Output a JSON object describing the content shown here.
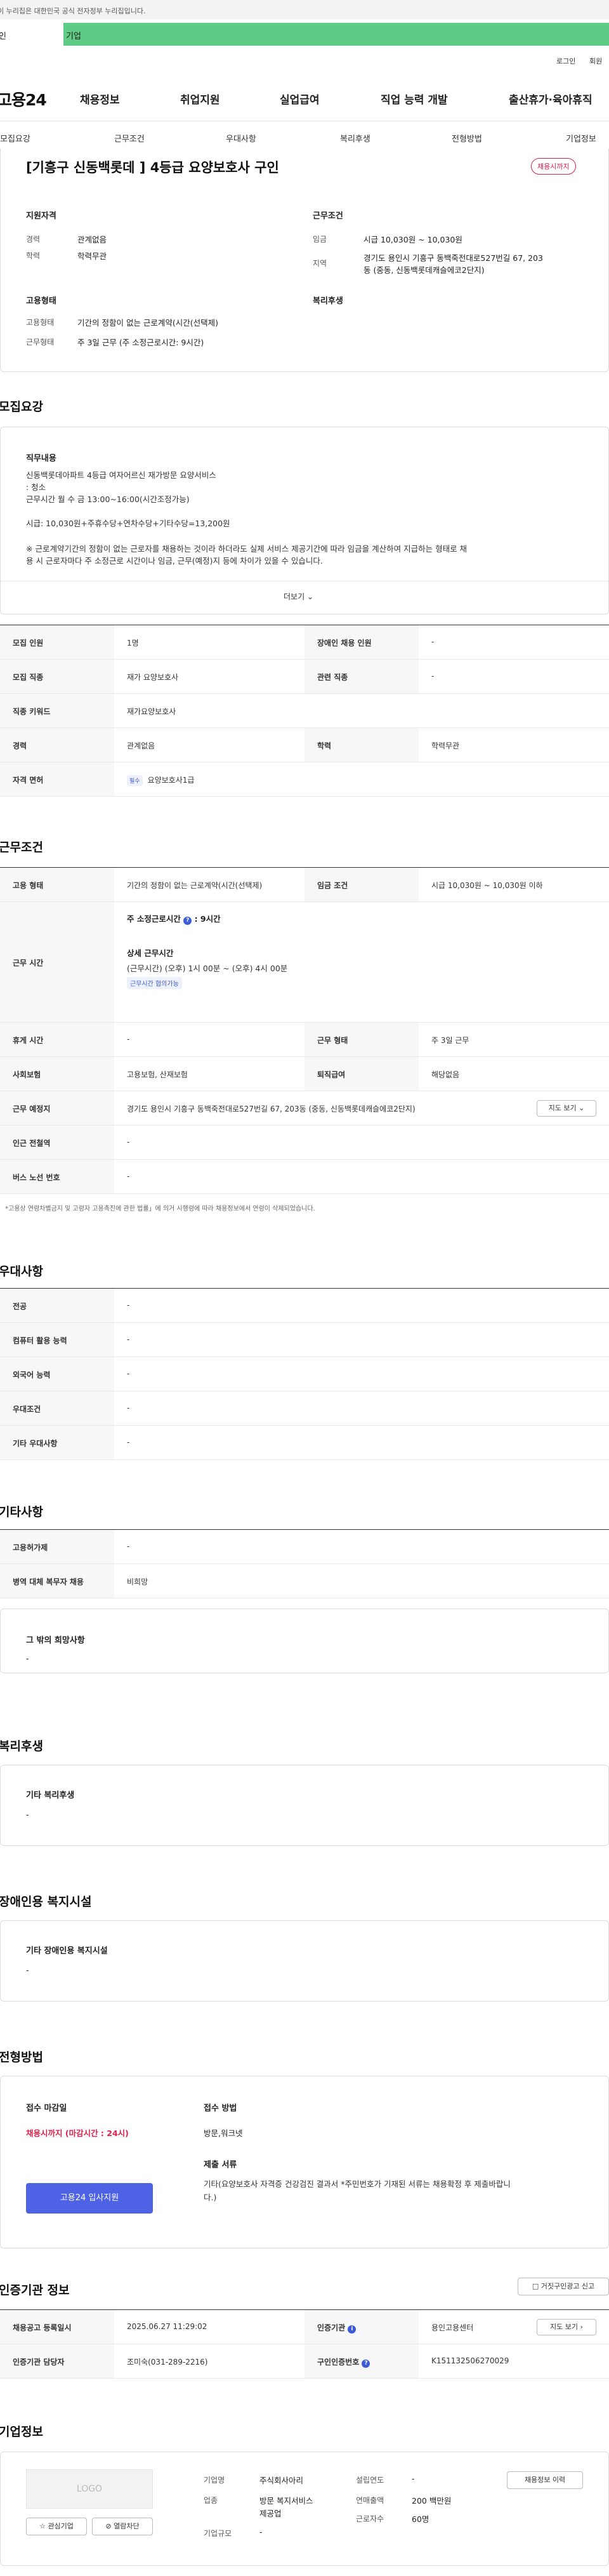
{
  "topbar": {
    "notice": "이 누리집은 대한민국 공식 전자정부 누리집입니다."
  },
  "banner": {
    "left": "인",
    "text": "기업"
  },
  "util": {
    "login": "로그인",
    "join": "회원"
  },
  "header": {
    "logo": "고용24",
    "nav": [
      "채용정보",
      "취업지원",
      "실업급여",
      "직업 능력 개발",
      "출산휴가·육아휴직"
    ]
  },
  "tabs": [
    "모집요강",
    "근무조건",
    "우대사항",
    "복리후생",
    "전형방법",
    "기업정보"
  ],
  "job": {
    "title": "[기흥구 신동백롯데 ] 4등급 요양보호사 구인",
    "status": "채용시까지",
    "qual_title": "지원자격",
    "qual": [
      {
        "label": "경력",
        "value": "관계없음"
      },
      {
        "label": "학력",
        "value": "학력무관"
      }
    ],
    "cond_title": "근무조건",
    "cond": [
      {
        "label": "임금",
        "value": "시급 10,030원 ~ 10,030원"
      },
      {
        "label": "지역",
        "value": "경기도 용인시 기흥구 동백죽전대로527번길 67, 203"
      },
      {
        "label": "",
        "value": "동 (중동, 신동백롯데캐슬에코2단지)"
      }
    ],
    "emp_title": "고용형태",
    "emp": [
      {
        "label": "고용형태",
        "value": "기간의 정함이 없는 근로계약(시간(선택제)"
      },
      {
        "label": "근무형태",
        "value": "주 3일 근무 (주 소정근로시간: 9시간)"
      }
    ],
    "welfare_title": "복리후생"
  },
  "recruit": {
    "title": "모집요강",
    "duty_title": "직무내용",
    "duty_lines": [
      "신동백롯데아파트 4등급 여자어르신 재가방문 요양서비스",
      ": 청소",
      "근무시간 월 수 금 13:00~16:00(시간조정가능)",
      "",
      "시급: 10,030원+주휴수당+연차수당+기타수당=13,200원",
      "",
      "※ 근로계약기간의 정함이 없는 근로자를 채용하는 것이라 하더라도 실제 서비스 제공기간에 따라 임금을 계산하여 지급하는 형태로 채",
      "용 시 근로자마다 주 소정근로 시간이나 임금, 근무(예정)지 등에 차이가 있을 수 있습니다."
    ],
    "more": "더보기",
    "rows": [
      {
        "l1": "모집 인원",
        "v1": "1명",
        "l2": "장애인 채용 인원",
        "v2": "-"
      },
      {
        "l1": "모집 직종",
        "v1": "재가 요양보호사",
        "l2": "관련 직종",
        "v2": "-"
      },
      {
        "l1": "직종 키워드",
        "v1": "재가요양보호사",
        "l2": "",
        "v2": ""
      },
      {
        "l1": "경력",
        "v1": "관계없음",
        "l2": "학력",
        "v2": "학력무관"
      },
      {
        "l1": "자격 면허",
        "v1": "요양보호사1급",
        "l2": "",
        "v2": ""
      }
    ],
    "license_badge": "필수"
  },
  "work": {
    "title": "근무조건",
    "rows": [
      {
        "l1": "고용 형태",
        "v1": "기간의 정함이 없는 근로계약(시간(선택제)",
        "l2": "임금 조건",
        "v2": "시급 10,030원 ~ 10,030원 이하"
      },
      {
        "l1": "휴게 시간",
        "v1": "-",
        "l2": "근무 형태",
        "v2": "주 3일 근무"
      },
      {
        "l1": "사회보험",
        "v1": "고용보험, 산재보험",
        "l2": "퇴직급여",
        "v2": "해당없음"
      }
    ],
    "hours_label": "근무 시간",
    "hours_main": "주 소정근로시간",
    "hours_value": ": 9시간",
    "hours_detail_title": "상세 근무시간",
    "hours_detail": "(근무시간) (오후) 1시 00분 ~ (오후) 4시 00분",
    "hours_badge": "근무시간 협의가능",
    "place_label": "근무 예정지",
    "place_value": "경기도 용인시 기흥구 동백죽전대로527번길 67, 203동 (중동, 신동백롯데캐슬에코2단지)",
    "map_btn": "지도 보기",
    "extra": [
      {
        "label": "인근 전철역",
        "value": "-"
      },
      {
        "label": "버스 노선 번호",
        "value": "-"
      }
    ],
    "note": "*고용상 연령차별금지 및 고령자 고용촉진에 관한 법률」에 의거 시행령에 따라 채용정보에서 연령이 삭제되었습니다."
  },
  "pref": {
    "title": "우대사항",
    "rows": [
      {
        "label": "전공",
        "value": "-"
      },
      {
        "label": "컴퓨터 활용 능력",
        "value": "-"
      },
      {
        "label": "외국어 능력",
        "value": "-"
      },
      {
        "label": "우대조건",
        "value": "-"
      },
      {
        "label": "기타 우대사항",
        "value": "-"
      }
    ]
  },
  "etc": {
    "title": "기타사항",
    "rows": [
      {
        "label": "고용허가제",
        "value": "-"
      },
      {
        "label": "병역 대체 복무자 채용",
        "value": "비희망"
      }
    ],
    "box_title": "그 밖의 희망사항",
    "box_value": "-"
  },
  "benefit": {
    "title": "복리후생",
    "box_title": "기타 복리후생",
    "box_value": "-"
  },
  "disab": {
    "title": "장애인용 복지시설",
    "box_title": "기타 장애인용 복지시설",
    "box_value": "-"
  },
  "select": {
    "title": "전형방법",
    "deadline_title": "접수 마감일",
    "deadline": "채용시까지 (마감시간 : 24시)",
    "apply_btn": "고용24 입사지원",
    "method_title": "접수 방법",
    "method": "방문,워크넷",
    "docs_title": "제출 서류",
    "docs": [
      "기타(요양보호사 자격증 건강검진 결과서 *주민번호가 기재된 서류는 채용확정 후 제출바랍니",
      "다.)"
    ]
  },
  "agency": {
    "title": "인증기관 정보",
    "report_btn": "거짓구인광고 신고",
    "rows": [
      {
        "l1": "채용공고 등록일시",
        "v1": "2025.06.27 11:29:02",
        "l2": "인증기관",
        "v2": "용인고용센터"
      },
      {
        "l1": "인증기관 담당자",
        "v1": "조미숙(031-289-2216)",
        "l2": "구인인증번호",
        "v2": "K151132506270029"
      }
    ],
    "map_btn": "지도 보기"
  },
  "company": {
    "title": "기업정보",
    "logo_text": "LOGO",
    "fav_btn": "관심기업",
    "block_btn": "열람차단",
    "info": [
      {
        "label": "기업명",
        "value": "주식회사아리"
      },
      {
        "label": "업종",
        "value": "방문 복지서비스"
      },
      {
        "label": "",
        "value": "제공업"
      },
      {
        "label": "기업규모",
        "value": "-"
      }
    ],
    "info2": [
      {
        "label": "설립연도",
        "value": "-"
      },
      {
        "label": "연매출액",
        "value": "200 백만원"
      },
      {
        "label": "근로자수",
        "value": "60명"
      }
    ],
    "jobs_btn": "채용정보 이력"
  }
}
